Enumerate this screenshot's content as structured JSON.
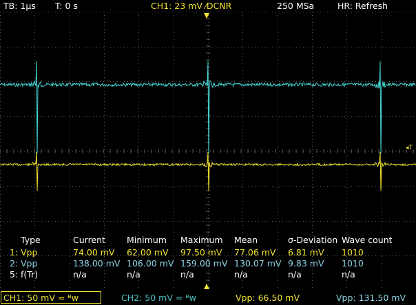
{
  "topbar": {
    "timebase": "TB: 1µs",
    "trigger_time": "T: 0 s",
    "channel_setting": "CH1: 23 mV ⁄DCNR",
    "sample_rate": "250 MSa",
    "history_mode": "HR: Refresh"
  },
  "colors": {
    "ch1": "#f1e332",
    "ch2": "#45d8d6",
    "grid": "#5a5a5a"
  },
  "trigger_marker": "◂T",
  "measurements": {
    "headers": [
      "Type",
      "Current",
      "Minimum",
      "Maximum",
      "Mean",
      "σ-Deviation",
      "Wave count"
    ],
    "rows": [
      {
        "index": "1:",
        "type": "Vpp",
        "current": "74.00 mV",
        "minimum": "62.00 mV",
        "maximum": "97.50 mV",
        "mean": "77.06 mV",
        "sigma": "6.81 mV",
        "count": "1010"
      },
      {
        "index": "2:",
        "type": "Vpp",
        "current": "138.00 mV",
        "minimum": "106.00 mV",
        "maximum": "159.00 mV",
        "mean": "130.07 mV",
        "sigma": "9.83 mV",
        "count": "1010"
      },
      {
        "index": "5:",
        "type": "f(Tr)",
        "current": "n/a",
        "minimum": "n/a",
        "maximum": "n/a",
        "mean": "n/a",
        "sigma": "n/a",
        "count": "n/a"
      }
    ]
  },
  "bottombar": {
    "ch1_label": "CH1: 50 mV ≈ ᴮw",
    "ch2_label": "CH2: 50 mV ≈ ᴮw",
    "vpp_ch1": "Vpp: 66.50 mV",
    "vpp_ch2": "Vpp: 131.50 mV"
  }
}
